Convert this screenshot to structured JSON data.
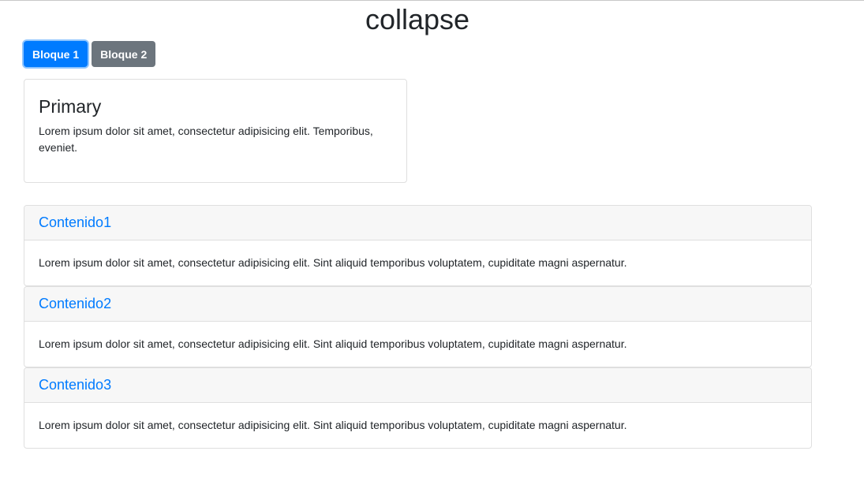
{
  "page": {
    "title": "collapse"
  },
  "buttons": {
    "bloque1": "Bloque 1",
    "bloque2": "Bloque 2"
  },
  "card": {
    "title": "Primary",
    "text": "Lorem ipsum dolor sit amet, consectetur adipisicing elit. Temporibus, eveniet."
  },
  "accordion": {
    "items": [
      {
        "title": "Contenido1",
        "body": "Lorem ipsum dolor sit amet, consectetur adipisicing elit. Sint aliquid temporibus voluptatem, cupiditate magni aspernatur."
      },
      {
        "title": "Contenido2",
        "body": "Lorem ipsum dolor sit amet, consectetur adipisicing elit. Sint aliquid temporibus voluptatem, cupiditate magni aspernatur."
      },
      {
        "title": "Contenido3",
        "body": "Lorem ipsum dolor sit amet, consectetur adipisicing elit. Sint aliquid temporibus voluptatem, cupiditate magni aspernatur."
      }
    ]
  },
  "colors": {
    "primary": "#007bff",
    "secondary": "#6c757d",
    "header_bg": "#f7f7f7",
    "border": "#dfdfdf"
  }
}
